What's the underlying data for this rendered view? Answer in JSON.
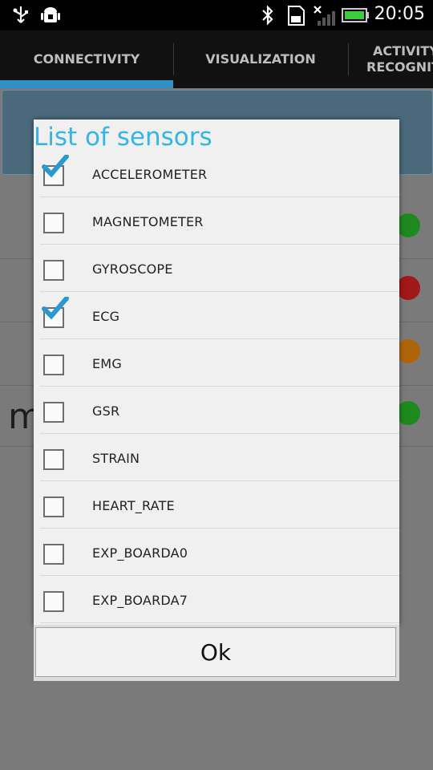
{
  "status_bar": {
    "time": "20:05",
    "icons": [
      "usb-icon",
      "android-debug-icon",
      "bluetooth-icon",
      "sd-card-icon",
      "signal-icon",
      "battery-icon"
    ]
  },
  "tabs": [
    {
      "label": "CONNECTIVITY"
    },
    {
      "label": "VISUALIZATION"
    },
    {
      "label": "ACTIVITY RECOGNITI"
    }
  ],
  "dialog": {
    "title": "List of sensors",
    "items": [
      {
        "label": "ACCELEROMETER",
        "checked": true
      },
      {
        "label": "MAGNETOMETER",
        "checked": false
      },
      {
        "label": "GYROSCOPE",
        "checked": false
      },
      {
        "label": "ECG",
        "checked": true
      },
      {
        "label": "EMG",
        "checked": false
      },
      {
        "label": "GSR",
        "checked": false
      },
      {
        "label": "STRAIN",
        "checked": false
      },
      {
        "label": "HEART_RATE",
        "checked": false
      },
      {
        "label": "EXP_BOARDA0",
        "checked": false
      },
      {
        "label": "EXP_BOARDA7",
        "checked": false
      }
    ],
    "ok_label": "Ok"
  },
  "background": {
    "fragment_text": "m",
    "status_colors": [
      "#1e8a1e",
      "#a01818",
      "#b0640a",
      "#1e8a1e"
    ]
  },
  "colors": {
    "accent": "#33b5e5",
    "tab_indicator": "#2f8fc7"
  }
}
